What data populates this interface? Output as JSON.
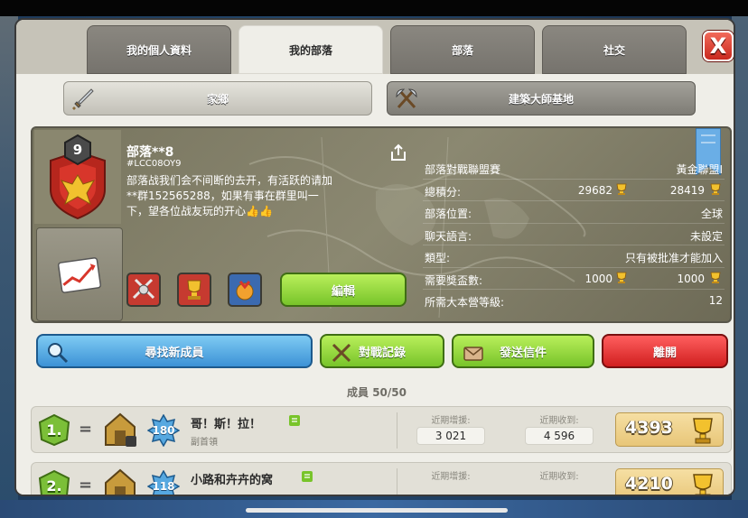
{
  "tabs": [
    {
      "label": "我的個人資料",
      "active": false
    },
    {
      "label": "我的部落",
      "active": true
    },
    {
      "label": "部落",
      "active": false
    },
    {
      "label": "社交",
      "active": false
    }
  ],
  "close_label": "X",
  "base_buttons": {
    "home": "家鄉",
    "builder": "建築大師基地"
  },
  "clan": {
    "level": "9",
    "name": "部落**8",
    "tag": "#LCC08OY9",
    "description": "部落战我们会不间断的去开，有活跃的请加**群152565288，如果有事在群里叫一下，望各位战友玩的开心👍👍",
    "edit_label": "編輯"
  },
  "stats": [
    {
      "label": "部落對戰聯盟賽",
      "value": "黃金聯盟I"
    },
    {
      "label": "總積分:",
      "value1": "29682",
      "value2": "28419"
    },
    {
      "label": "部落位置:",
      "value": "全球"
    },
    {
      "label": "聊天語言:",
      "value": "未設定"
    },
    {
      "label": "類型:",
      "value": "只有被批准才能加入"
    },
    {
      "label": "需要獎盃數:",
      "value1": "1000",
      "value2": "1000"
    },
    {
      "label": "所需大本營等級:",
      "value": "12"
    }
  ],
  "actions": {
    "find": "尋找新成員",
    "war_log": "對戰記錄",
    "send_mail": "發送信件",
    "leave": "離開"
  },
  "members_header": "成員 50/50",
  "members": [
    {
      "rank": "1.",
      "level": "180",
      "name": "哥！斯！拉！",
      "role": "副首領",
      "donated_label": "近期增援:",
      "donated": "3 021",
      "received_label": "近期收到:",
      "received": "4 596",
      "trophies": "4393"
    },
    {
      "rank": "2.",
      "level": "118",
      "name": "小路和卉卉的窝",
      "role": "",
      "donated_label": "近期增援:",
      "donated": "",
      "received_label": "近期收到:",
      "received": "",
      "trophies": "4210"
    }
  ],
  "colors": {
    "green_button": "#78c42a",
    "blue_button": "#3c92d6",
    "red_button": "#d11f1f",
    "panel": "#8b8871"
  }
}
